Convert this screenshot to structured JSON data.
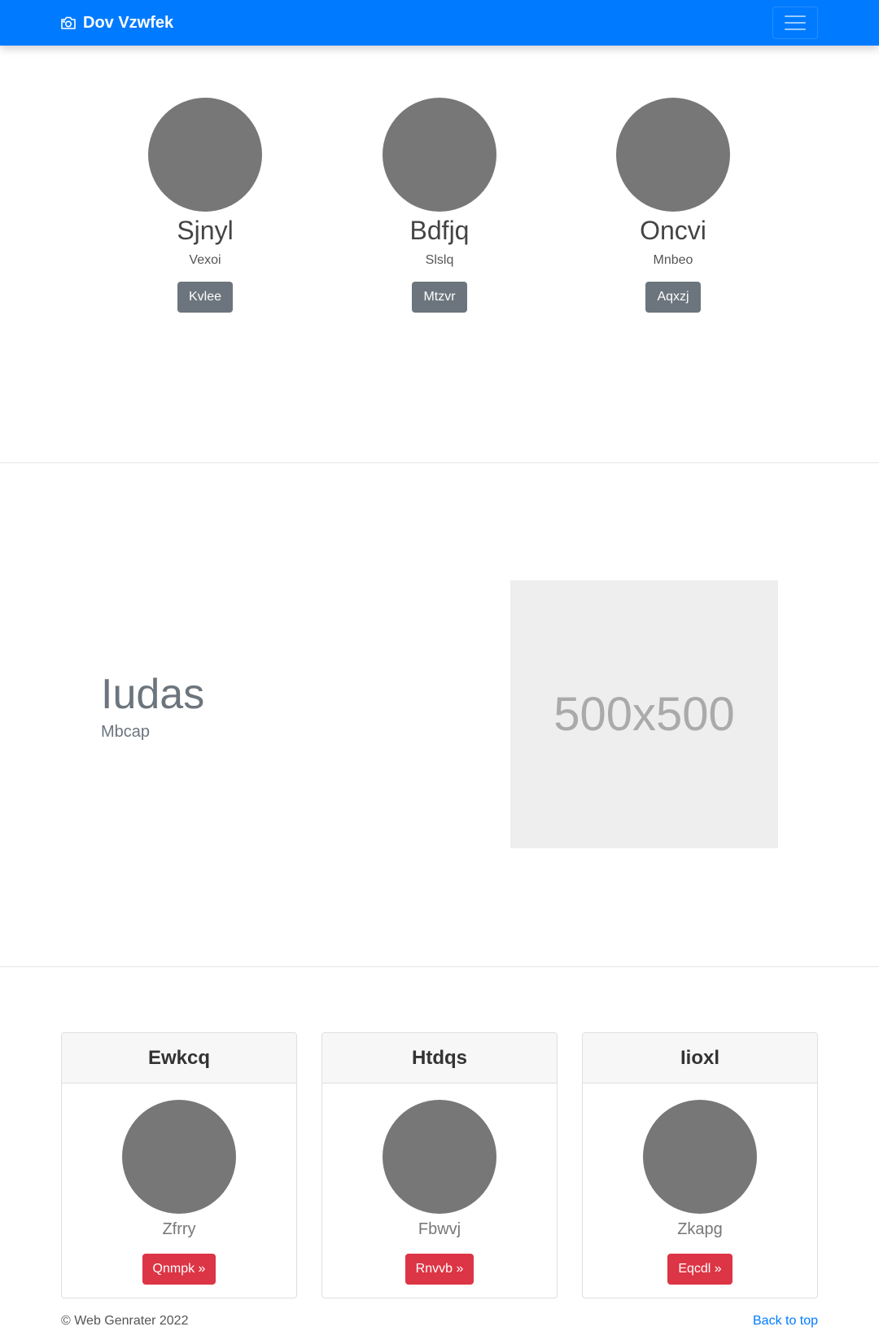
{
  "navbar": {
    "brand": "Dov Vzwfek",
    "brand_icon": "camera-icon",
    "menu_icon": "hamburger-icon",
    "color": "#007bff"
  },
  "team": [
    {
      "name": "Sjnyl",
      "role": "Vexoi",
      "button": "Kvlee"
    },
    {
      "name": "Bdfjq",
      "role": "Slslq",
      "button": "Mtzvr"
    },
    {
      "name": "Oncvi",
      "role": "Mnbeo",
      "button": "Aqxzj"
    }
  ],
  "feature": {
    "heading": "Iudas",
    "subheading": "Mbcap",
    "image_placeholder": "500x500"
  },
  "cards": [
    {
      "title": "Ewkcq",
      "text": "Zfrry",
      "button": "Qnmpk »"
    },
    {
      "title": "Htdqs",
      "text": "Fbwvj",
      "button": "Rnvvb »"
    },
    {
      "title": "Iioxl",
      "text": "Zkapg",
      "button": "Eqcdl »"
    }
  ],
  "footer": {
    "copyright": "© Web Genrater 2022",
    "back_to_top": "Back to top"
  },
  "colors": {
    "primary": "#007bff",
    "secondary": "#6c757d",
    "danger": "#dc3545"
  }
}
